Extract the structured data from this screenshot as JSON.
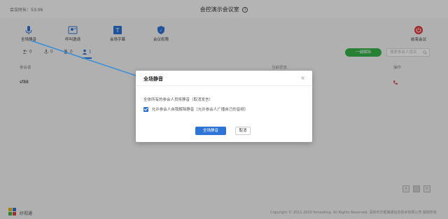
{
  "header": {
    "meeting_time": "会议时长：53:06",
    "title": "会控演示会议室"
  },
  "toolbar": {
    "mute_all": "全场静音",
    "invite": "呼叫邀请",
    "subtitle": "会场字幕",
    "security": "会议权限",
    "end_meeting": "结束会议"
  },
  "tabs": [
    {
      "count": "0"
    },
    {
      "count": "0"
    },
    {
      "count": "0"
    },
    {
      "count": "1"
    }
  ],
  "actions": {
    "unmute_all": "一键解除",
    "search_placeholder": "搜索参会人姓名"
  },
  "table": {
    "col_name": "参会者",
    "col_status": "当前状态",
    "col_ops": "操作",
    "rows": [
      {
        "name": "sf88"
      }
    ]
  },
  "dialog": {
    "title": "全场静音",
    "description": "全体所有的参会人员将静音（取消发言）",
    "checkbox_label": "允许参会人自我解除静音（允许参会人广播自己的音频）",
    "confirm": "全场静音",
    "cancel": "取消"
  },
  "footer": {
    "brand": "好视通",
    "copyright": "Copyright © 2011-2020 fsmeeting. All Rights Reserved. 深圳市华视瑞通信息技术有限公司 版权所有"
  },
  "colors": {
    "primary": "#2d74d9",
    "success": "#35b34a",
    "danger": "#e03c3c"
  }
}
